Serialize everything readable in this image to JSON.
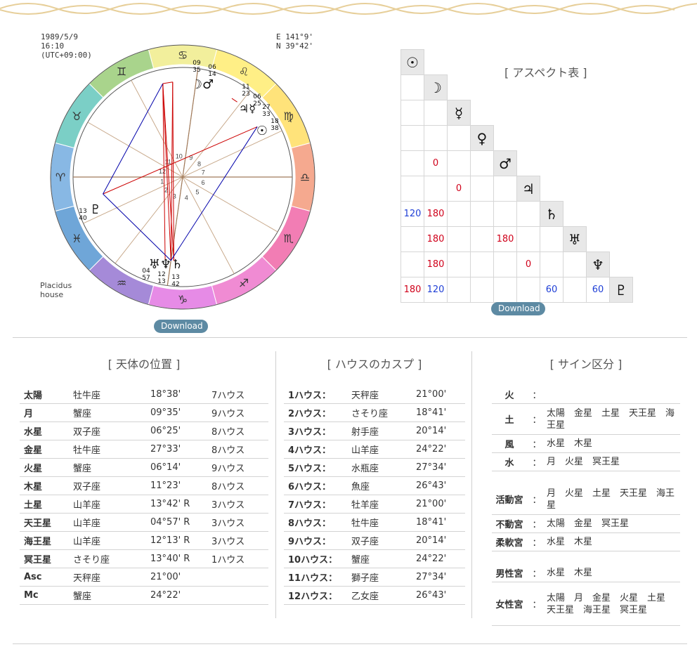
{
  "chart_meta": {
    "date": "1989/5/9",
    "time": "16:10",
    "tz": "(UTC+09:00)",
    "lon": "E 141°9'",
    "lat": "N 39°42'",
    "house_system_line1": "Placidus",
    "house_system_line2": "house"
  },
  "wheel": {
    "sign_glyphs": [
      "♌",
      "♋",
      "♊",
      "♉",
      "♈",
      "♓",
      "♒",
      "♑",
      "♐",
      "♏",
      "♎",
      "♍"
    ],
    "house_numbers": [
      "1",
      "2",
      "3",
      "4",
      "5",
      "6",
      "7",
      "8",
      "9",
      "10",
      "11",
      "12"
    ],
    "planet_labels": {
      "moon_mars": {
        "glyphs": "☽♂",
        "deg1": "09",
        "min1": "35",
        "deg2": "06",
        "min2": "14"
      },
      "jup_mer": {
        "glyphs": "♃☿",
        "deg1": "11",
        "min1": "23",
        "deg2": "06",
        "min2": "25"
      },
      "venus": {
        "deg": "27",
        "min": "33"
      },
      "sun": {
        "glyph": "☉",
        "deg": "18",
        "min": "38"
      },
      "pluto": {
        "glyph": "♇",
        "deg": "13",
        "min": "40"
      },
      "outer": {
        "glyphs": "♅♆♄",
        "u_deg": "04",
        "u_min": "57",
        "n_deg": "12",
        "n_min": "13",
        "s_deg": "13",
        "s_min": "42"
      }
    }
  },
  "download_label": "Download",
  "aspect": {
    "title": "[ アスペクト表 ]",
    "symbols": [
      "☉",
      "☽",
      "☿",
      "♀",
      "♂",
      "♃",
      "♄",
      "♅",
      "♆",
      "♇"
    ],
    "rows": [
      [],
      [
        ""
      ],
      [
        "",
        ""
      ],
      [
        "",
        "",
        ""
      ],
      [
        "",
        "0",
        "",
        ""
      ],
      [
        "",
        "",
        "0",
        "",
        ""
      ],
      [
        "120",
        "180",
        "",
        "",
        "",
        ""
      ],
      [
        "",
        "180",
        "",
        "",
        "180",
        "",
        ""
      ],
      [
        "",
        "180",
        "",
        "",
        "",
        "0",
        "",
        ""
      ],
      [
        "180",
        "120",
        "",
        "",
        "",
        "",
        "60",
        "",
        "60"
      ]
    ],
    "colors": {
      "120": "blue",
      "60": "blue",
      "180": "red",
      "0": "red"
    }
  },
  "planets": {
    "title": "[ 天体の位置 ]",
    "rows": [
      [
        "太陽",
        "牡牛座",
        "18°38'",
        "7ハウス"
      ],
      [
        "月",
        "蟹座",
        "09°35'",
        "9ハウス"
      ],
      [
        "水星",
        "双子座",
        "06°25'",
        "8ハウス"
      ],
      [
        "金星",
        "牡牛座",
        "27°33'",
        "8ハウス"
      ],
      [
        "火星",
        "蟹座",
        "06°14'",
        "9ハウス"
      ],
      [
        "木星",
        "双子座",
        "11°23'",
        "8ハウス"
      ],
      [
        "土星",
        "山羊座",
        "13°42' R",
        "3ハウス"
      ],
      [
        "天王星",
        "山羊座",
        "04°57' R",
        "3ハウス"
      ],
      [
        "海王星",
        "山羊座",
        "12°13' R",
        "3ハウス"
      ],
      [
        "冥王星",
        "さそり座",
        "13°40' R",
        "1ハウス"
      ],
      [
        "Asc",
        "天秤座",
        "21°00'",
        ""
      ],
      [
        "Mc",
        "蟹座",
        "24°22'",
        ""
      ]
    ]
  },
  "houses": {
    "title": "[ ハウスのカスプ ]",
    "rows": [
      [
        "1ハウス：",
        "天秤座",
        "21°00'"
      ],
      [
        "2ハウス：",
        "さそり座",
        "18°41'"
      ],
      [
        "3ハウス：",
        "射手座",
        "20°14'"
      ],
      [
        "4ハウス：",
        "山羊座",
        "24°22'"
      ],
      [
        "5ハウス：",
        "水瓶座",
        "27°34'"
      ],
      [
        "6ハウス：",
        "魚座",
        "26°43'"
      ],
      [
        "7ハウス：",
        "牡羊座",
        "21°00'"
      ],
      [
        "8ハウス：",
        "牡牛座",
        "18°41'"
      ],
      [
        "9ハウス：",
        "双子座",
        "20°14'"
      ],
      [
        "10ハウス：",
        "蟹座",
        "24°22'"
      ],
      [
        "11ハウス：",
        "獅子座",
        "27°34'"
      ],
      [
        "12ハウス：",
        "乙女座",
        "26°43'"
      ]
    ]
  },
  "signs": {
    "title": "[ サイン区分 ]",
    "colon": "：",
    "elements": [
      {
        "label": "火",
        "value": ""
      },
      {
        "label": "土",
        "value": "太陽　金星　土星　天王星　海王星"
      },
      {
        "label": "風",
        "value": "水星　木星"
      },
      {
        "label": "水",
        "value": "月　火星　冥王星"
      }
    ],
    "modes": [
      {
        "label": "活動宮",
        "value": "月　火星　土星　天王星　海王星"
      },
      {
        "label": "不動宮",
        "value": "太陽　金星　冥王星"
      },
      {
        "label": "柔軟宮",
        "value": "水星　木星"
      }
    ],
    "polarity": [
      {
        "label": "男性宮",
        "value": "水星　木星"
      },
      {
        "label": "女性宮",
        "value": "太陽　月　金星　火星　土星　天王星　海王星　冥王星"
      }
    ]
  }
}
